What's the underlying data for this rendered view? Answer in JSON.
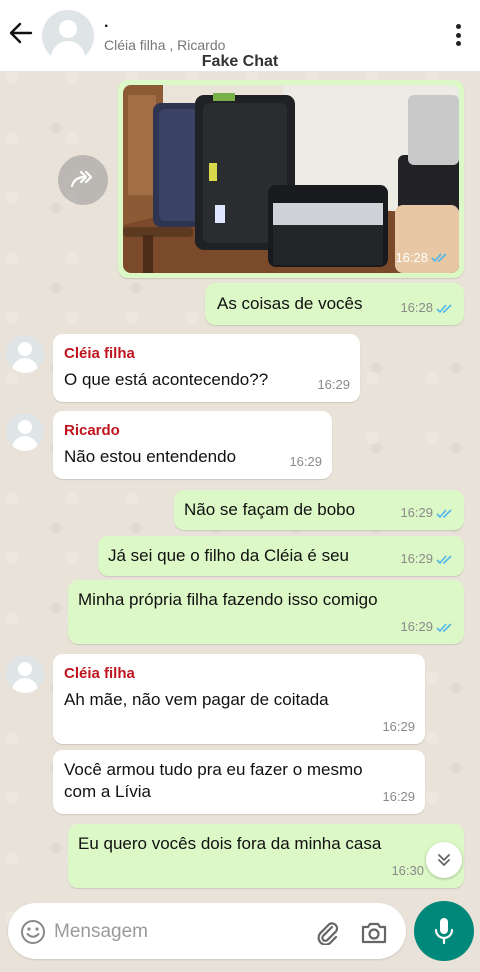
{
  "header": {
    "title": ".",
    "participants": "Cléia filha , Ricardo",
    "watermark": "Fake Chat"
  },
  "photo": {
    "time": "16:28"
  },
  "messages": [
    {
      "dir": "out",
      "text": "As coisas de vocês",
      "time": "16:28"
    },
    {
      "dir": "in",
      "sender": "Cléia filha",
      "text": "O que está acontecendo??",
      "time": "16:29"
    },
    {
      "dir": "in",
      "sender": "Ricardo",
      "text": "Não estou entendendo",
      "time": "16:29"
    },
    {
      "dir": "out",
      "text": "Não se façam de bobo",
      "time": "16:29"
    },
    {
      "dir": "out",
      "text": "Já sei que o filho da Cléia é seu",
      "time": "16:29"
    },
    {
      "dir": "out",
      "text": "Minha própria filha fazendo isso comigo",
      "time": "16:29"
    },
    {
      "dir": "in",
      "sender": "Cléia filha",
      "text": "Ah mãe, não vem pagar de coitada",
      "time": "16:29"
    },
    {
      "dir": "in",
      "text": "Você armou tudo pra eu fazer o mesmo com a Lívia",
      "time": "16:29"
    },
    {
      "dir": "out",
      "text": "Eu quero vocês dois fora da minha casa",
      "time": "16:30"
    }
  ],
  "composer": {
    "placeholder": "Mensagem"
  },
  "colors": {
    "outgoing_bubble": "#dcf8c6",
    "incoming_bubble": "#ffffff",
    "sender_name": "#c0151f",
    "read_ticks": "#4fb6ec",
    "mic_button": "#00897b"
  },
  "icons": [
    "back-arrow-icon",
    "avatar-icon",
    "menu-kebab-icon",
    "forward-icon",
    "double-check-icon",
    "chevron-double-down-icon",
    "emoji-icon",
    "attachment-icon",
    "camera-icon",
    "mic-icon"
  ]
}
